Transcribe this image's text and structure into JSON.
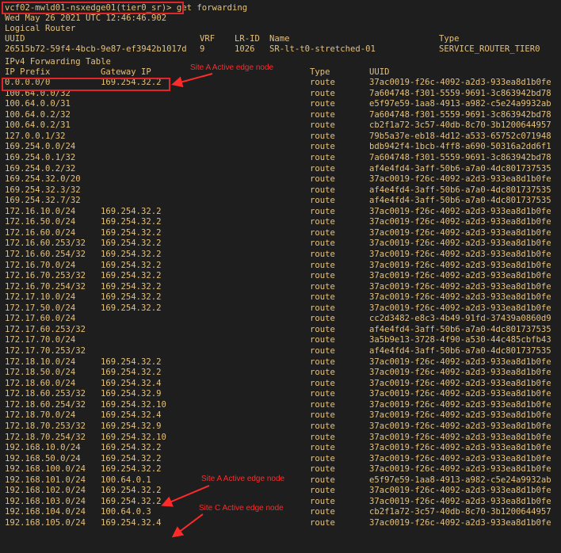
{
  "prompt": "vcf02-mwld01-nsxedge01(tier0_sr)> get forwarding",
  "timestamp": "Wed May 26 2021 UTC 12:46:46.902",
  "section_logical_router": "Logical Router",
  "router_table": {
    "headers": {
      "uuid": "UUID",
      "vrf": "VRF",
      "lr_id": "LR-ID",
      "name": "Name",
      "type": "Type"
    },
    "row": {
      "uuid": "26515b72-59f4-4bcb-9e87-ef3942b1017d",
      "vrf": "9",
      "lr_id": "1026",
      "name": "SR-lt-t0-stretched-01",
      "type": "SERVICE_ROUTER_TIER0"
    }
  },
  "section_forwarding": "IPv4 Forwarding Table",
  "forwarding_headers": {
    "prefix": "IP Prefix",
    "gateway": "Gateway IP",
    "type": "Type",
    "uuid": "UUID"
  },
  "routes": [
    {
      "prefix": "0.0.0.0/0",
      "gateway": "169.254.32.2",
      "type": "route",
      "uuid": "37ac0019-f26c-4092-a2d3-933ea8d1b0fe"
    },
    {
      "prefix": "100.64.0.0/32",
      "gateway": "",
      "type": "route",
      "uuid": "7a604748-f301-5559-9691-3c863942bd78"
    },
    {
      "prefix": "100.64.0.0/31",
      "gateway": "",
      "type": "route",
      "uuid": "e5f97e59-1aa8-4913-a982-c5e24a9932ab"
    },
    {
      "prefix": "100.64.0.2/32",
      "gateway": "",
      "type": "route",
      "uuid": "7a604748-f301-5559-9691-3c863942bd78"
    },
    {
      "prefix": "100.64.0.2/31",
      "gateway": "",
      "type": "route",
      "uuid": "cb2f1a72-3c57-40db-8c70-3b1200644957"
    },
    {
      "prefix": "127.0.0.1/32",
      "gateway": "",
      "type": "route",
      "uuid": "79b5a37e-eb18-4d12-a533-65752c071948"
    },
    {
      "prefix": "169.254.0.0/24",
      "gateway": "",
      "type": "route",
      "uuid": "bdb942f4-1bcb-4ff8-a690-50316a2dd6f1"
    },
    {
      "prefix": "169.254.0.1/32",
      "gateway": "",
      "type": "route",
      "uuid": "7a604748-f301-5559-9691-3c863942bd78"
    },
    {
      "prefix": "169.254.0.2/32",
      "gateway": "",
      "type": "route",
      "uuid": "af4e4fd4-3aff-50b6-a7a0-4dc801737535"
    },
    {
      "prefix": "169.254.32.0/20",
      "gateway": "",
      "type": "route",
      "uuid": "37ac0019-f26c-4092-a2d3-933ea8d1b0fe"
    },
    {
      "prefix": "169.254.32.3/32",
      "gateway": "",
      "type": "route",
      "uuid": "af4e4fd4-3aff-50b6-a7a0-4dc801737535"
    },
    {
      "prefix": "169.254.32.7/32",
      "gateway": "",
      "type": "route",
      "uuid": "af4e4fd4-3aff-50b6-a7a0-4dc801737535"
    },
    {
      "prefix": "172.16.10.0/24",
      "gateway": "169.254.32.2",
      "type": "route",
      "uuid": "37ac0019-f26c-4092-a2d3-933ea8d1b0fe"
    },
    {
      "prefix": "172.16.50.0/24",
      "gateway": "169.254.32.2",
      "type": "route",
      "uuid": "37ac0019-f26c-4092-a2d3-933ea8d1b0fe"
    },
    {
      "prefix": "172.16.60.0/24",
      "gateway": "169.254.32.2",
      "type": "route",
      "uuid": "37ac0019-f26c-4092-a2d3-933ea8d1b0fe"
    },
    {
      "prefix": "172.16.60.253/32",
      "gateway": "169.254.32.2",
      "type": "route",
      "uuid": "37ac0019-f26c-4092-a2d3-933ea8d1b0fe"
    },
    {
      "prefix": "172.16.60.254/32",
      "gateway": "169.254.32.2",
      "type": "route",
      "uuid": "37ac0019-f26c-4092-a2d3-933ea8d1b0fe"
    },
    {
      "prefix": "172.16.70.0/24",
      "gateway": "169.254.32.2",
      "type": "route",
      "uuid": "37ac0019-f26c-4092-a2d3-933ea8d1b0fe"
    },
    {
      "prefix": "172.16.70.253/32",
      "gateway": "169.254.32.2",
      "type": "route",
      "uuid": "37ac0019-f26c-4092-a2d3-933ea8d1b0fe"
    },
    {
      "prefix": "172.16.70.254/32",
      "gateway": "169.254.32.2",
      "type": "route",
      "uuid": "37ac0019-f26c-4092-a2d3-933ea8d1b0fe"
    },
    {
      "prefix": "172.17.10.0/24",
      "gateway": "169.254.32.2",
      "type": "route",
      "uuid": "37ac0019-f26c-4092-a2d3-933ea8d1b0fe"
    },
    {
      "prefix": "172.17.50.0/24",
      "gateway": "169.254.32.2",
      "type": "route",
      "uuid": "37ac0019-f26c-4092-a2d3-933ea8d1b0fe"
    },
    {
      "prefix": "172.17.60.0/24",
      "gateway": "",
      "type": "route",
      "uuid": "cc2d3482-e8c3-4b49-91fd-37439a0860d9"
    },
    {
      "prefix": "172.17.60.253/32",
      "gateway": "",
      "type": "route",
      "uuid": "af4e4fd4-3aff-50b6-a7a0-4dc801737535"
    },
    {
      "prefix": "172.17.70.0/24",
      "gateway": "",
      "type": "route",
      "uuid": "3a5b9e13-3728-4f90-a530-44c485cbfb43"
    },
    {
      "prefix": "172.17.70.253/32",
      "gateway": "",
      "type": "route",
      "uuid": "af4e4fd4-3aff-50b6-a7a0-4dc801737535"
    },
    {
      "prefix": "172.18.10.0/24",
      "gateway": "169.254.32.2",
      "type": "route",
      "uuid": "37ac0019-f26c-4092-a2d3-933ea8d1b0fe"
    },
    {
      "prefix": "172.18.50.0/24",
      "gateway": "169.254.32.2",
      "type": "route",
      "uuid": "37ac0019-f26c-4092-a2d3-933ea8d1b0fe"
    },
    {
      "prefix": "172.18.60.0/24",
      "gateway": "169.254.32.4",
      "type": "route",
      "uuid": "37ac0019-f26c-4092-a2d3-933ea8d1b0fe"
    },
    {
      "prefix": "172.18.60.253/32",
      "gateway": "169.254.32.9",
      "type": "route",
      "uuid": "37ac0019-f26c-4092-a2d3-933ea8d1b0fe"
    },
    {
      "prefix": "172.18.60.254/32",
      "gateway": "169.254.32.10",
      "type": "route",
      "uuid": "37ac0019-f26c-4092-a2d3-933ea8d1b0fe"
    },
    {
      "prefix": "172.18.70.0/24",
      "gateway": "169.254.32.4",
      "type": "route",
      "uuid": "37ac0019-f26c-4092-a2d3-933ea8d1b0fe"
    },
    {
      "prefix": "172.18.70.253/32",
      "gateway": "169.254.32.9",
      "type": "route",
      "uuid": "37ac0019-f26c-4092-a2d3-933ea8d1b0fe"
    },
    {
      "prefix": "172.18.70.254/32",
      "gateway": "169.254.32.10",
      "type": "route",
      "uuid": "37ac0019-f26c-4092-a2d3-933ea8d1b0fe"
    },
    {
      "prefix": "192.168.10.0/24",
      "gateway": "169.254.32.2",
      "type": "route",
      "uuid": "37ac0019-f26c-4092-a2d3-933ea8d1b0fe"
    },
    {
      "prefix": "192.168.50.0/24",
      "gateway": "169.254.32.2",
      "type": "route",
      "uuid": "37ac0019-f26c-4092-a2d3-933ea8d1b0fe"
    },
    {
      "prefix": "192.168.100.0/24",
      "gateway": "169.254.32.2",
      "type": "route",
      "uuid": "37ac0019-f26c-4092-a2d3-933ea8d1b0fe"
    },
    {
      "prefix": "192.168.101.0/24",
      "gateway": "100.64.0.1",
      "type": "route",
      "uuid": "e5f97e59-1aa8-4913-a982-c5e24a9932ab"
    },
    {
      "prefix": "192.168.102.0/24",
      "gateway": "169.254.32.2",
      "type": "route",
      "uuid": "37ac0019-f26c-4092-a2d3-933ea8d1b0fe"
    },
    {
      "prefix": "192.168.103.0/24",
      "gateway": "169.254.32.2",
      "type": "route",
      "uuid": "37ac0019-f26c-4092-a2d3-933ea8d1b0fe"
    },
    {
      "prefix": "192.168.104.0/24",
      "gateway": "100.64.0.3",
      "type": "route",
      "uuid": "cb2f1a72-3c57-40db-8c70-3b1200644957"
    },
    {
      "prefix": "192.168.105.0/24",
      "gateway": "169.254.32.4",
      "type": "route",
      "uuid": "37ac0019-f26c-4092-a2d3-933ea8d1b0fe"
    }
  ],
  "annotations": [
    {
      "text": "Site A Active edge node"
    },
    {
      "text": "Site A Active edge node"
    },
    {
      "text": "Site C Active edge node"
    }
  ],
  "colors": {
    "terminal_bg": "#1e1e1e",
    "terminal_text": "#e5c07b",
    "annotation": "#ff2a2a"
  }
}
